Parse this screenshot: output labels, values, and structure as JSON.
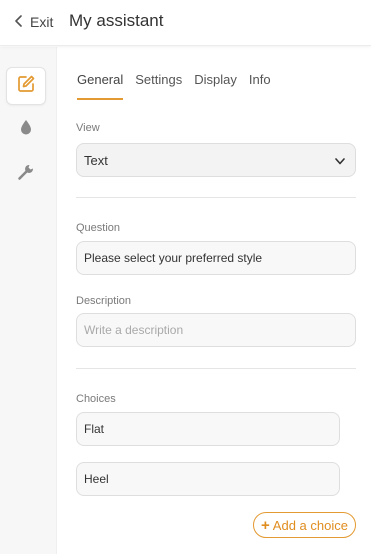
{
  "header": {
    "exit_label": "Exit",
    "title": "My assistant"
  },
  "sidebar": {
    "items": [
      {
        "icon": "edit-icon",
        "active": true
      },
      {
        "icon": "drop-icon",
        "active": false
      },
      {
        "icon": "wrench-icon",
        "active": false
      }
    ]
  },
  "tabs": [
    {
      "label": "General",
      "active": true
    },
    {
      "label": "Settings",
      "active": false
    },
    {
      "label": "Display",
      "active": false
    },
    {
      "label": "Info",
      "active": false
    }
  ],
  "view": {
    "label": "View",
    "value": "Text"
  },
  "question": {
    "label": "Question",
    "value": "Please select your preferred style"
  },
  "description": {
    "label": "Description",
    "placeholder": "Write a description"
  },
  "choices": {
    "label": "Choices",
    "items": [
      "Flat",
      "Heel"
    ],
    "add_label": "Add a choice"
  },
  "colors": {
    "accent": "#e39a32",
    "sidebar_bg": "#f7f7f7"
  }
}
